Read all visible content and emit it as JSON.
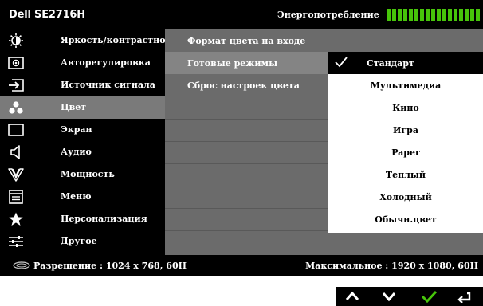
{
  "header": {
    "model": "Dell SE2716H",
    "energy_label": "Энергопотребление",
    "energy_color": "#47c50a"
  },
  "sidebar": {
    "items": [
      {
        "icon": "brightness-contrast-icon",
        "label": "Яркость/контрастность"
      },
      {
        "icon": "auto-adjust-icon",
        "label": "Авторегулировка"
      },
      {
        "icon": "input-source-icon",
        "label": "Источник сигнала"
      },
      {
        "icon": "color-icon",
        "label": "Цвет"
      },
      {
        "icon": "display-icon",
        "label": "Экран"
      },
      {
        "icon": "audio-icon",
        "label": "Аудио"
      },
      {
        "icon": "power-icon",
        "label": "Мощность"
      },
      {
        "icon": "menu-icon",
        "label": "Меню"
      },
      {
        "icon": "star-icon",
        "label": "Персонализация"
      },
      {
        "icon": "sliders-icon",
        "label": "Другое"
      }
    ],
    "active": "Цвет"
  },
  "submenu": {
    "items": [
      {
        "label": "Формат цвета на входе"
      },
      {
        "label": "Готовые режимы"
      },
      {
        "label": "Сброс настроек цвета"
      }
    ],
    "active": "Готовые режимы"
  },
  "options": {
    "items": [
      {
        "label": "Стандарт"
      },
      {
        "label": "Мультимедиа"
      },
      {
        "label": "Кино"
      },
      {
        "label": "Игра"
      },
      {
        "label": "Paper"
      },
      {
        "label": "Теплый"
      },
      {
        "label": "Холодный"
      },
      {
        "label": "Обычн.цвет"
      }
    ],
    "selected": "Стандарт"
  },
  "status": {
    "resolution": "Разрешение : 1024 x 768, 60H",
    "max_resolution": "Максимальное : 1920 x 1080, 60H"
  },
  "nav_buttons": [
    {
      "icon": "up-arrow-icon"
    },
    {
      "icon": "down-arrow-icon"
    },
    {
      "icon": "check-icon"
    },
    {
      "icon": "back-icon"
    }
  ]
}
